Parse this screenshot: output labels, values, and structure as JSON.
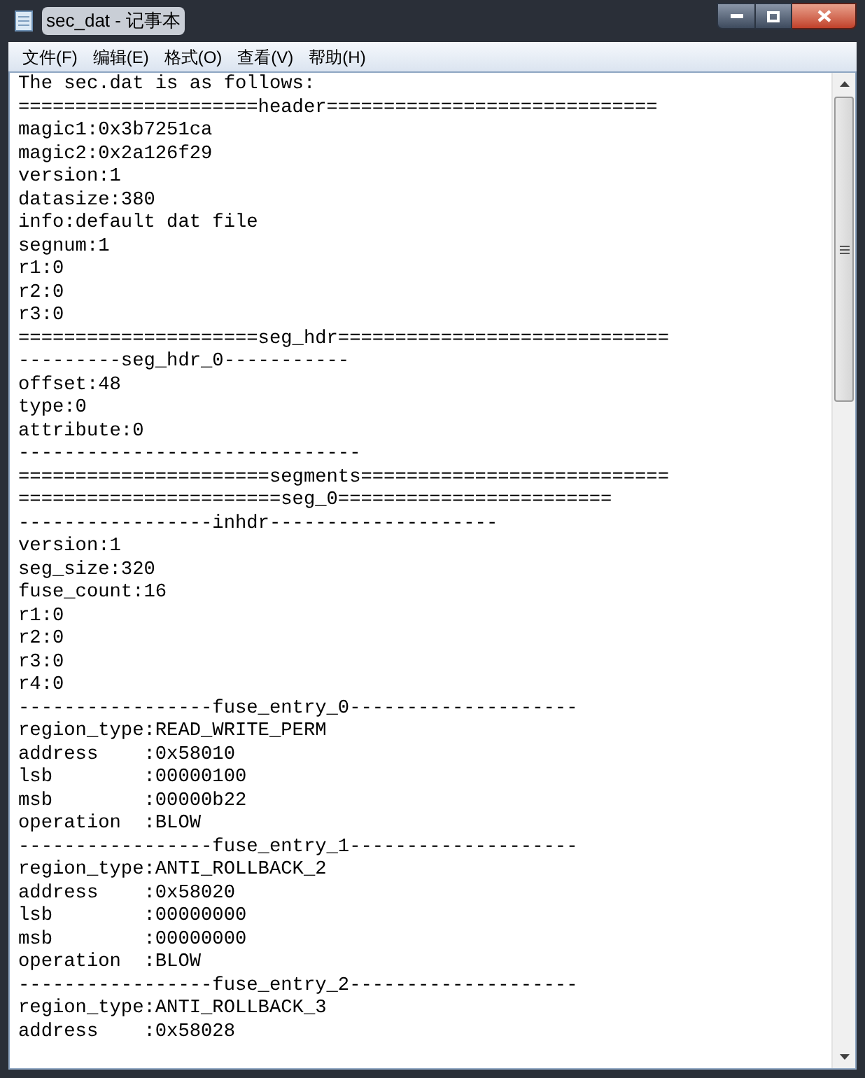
{
  "window": {
    "title": "sec_dat - 记事本"
  },
  "menu": [
    {
      "label": "文件(F)"
    },
    {
      "label": "编辑(E)"
    },
    {
      "label": "格式(O)"
    },
    {
      "label": "查看(V)"
    },
    {
      "label": "帮助(H)"
    }
  ],
  "lines": [
    "The sec.dat is as follows:",
    "=====================header=============================",
    "magic1:0x3b7251ca",
    "magic2:0x2a126f29",
    "version:1",
    "datasize:380",
    "info:default dat file",
    "segnum:1",
    "r1:0",
    "r2:0",
    "r3:0",
    "=====================seg_hdr=============================",
    "---------seg_hdr_0-----------",
    "offset:48",
    "type:0",
    "attribute:0",
    "------------------------------",
    "======================segments===========================",
    "=======================seg_0========================",
    "-----------------inhdr--------------------",
    "version:1",
    "seg_size:320",
    "fuse_count:16",
    "r1:0",
    "r2:0",
    "r3:0",
    "r4:0",
    "-----------------fuse_entry_0--------------------",
    "region_type:READ_WRITE_PERM",
    "address    :0x58010",
    "lsb        :00000100",
    "msb        :00000b22",
    "operation  :BLOW",
    "-----------------fuse_entry_1--------------------",
    "region_type:ANTI_ROLLBACK_2",
    "address    :0x58020",
    "lsb        :00000000",
    "msb        :00000000",
    "operation  :BLOW",
    "-----------------fuse_entry_2--------------------",
    "region_type:ANTI_ROLLBACK_3",
    "address    :0x58028"
  ]
}
